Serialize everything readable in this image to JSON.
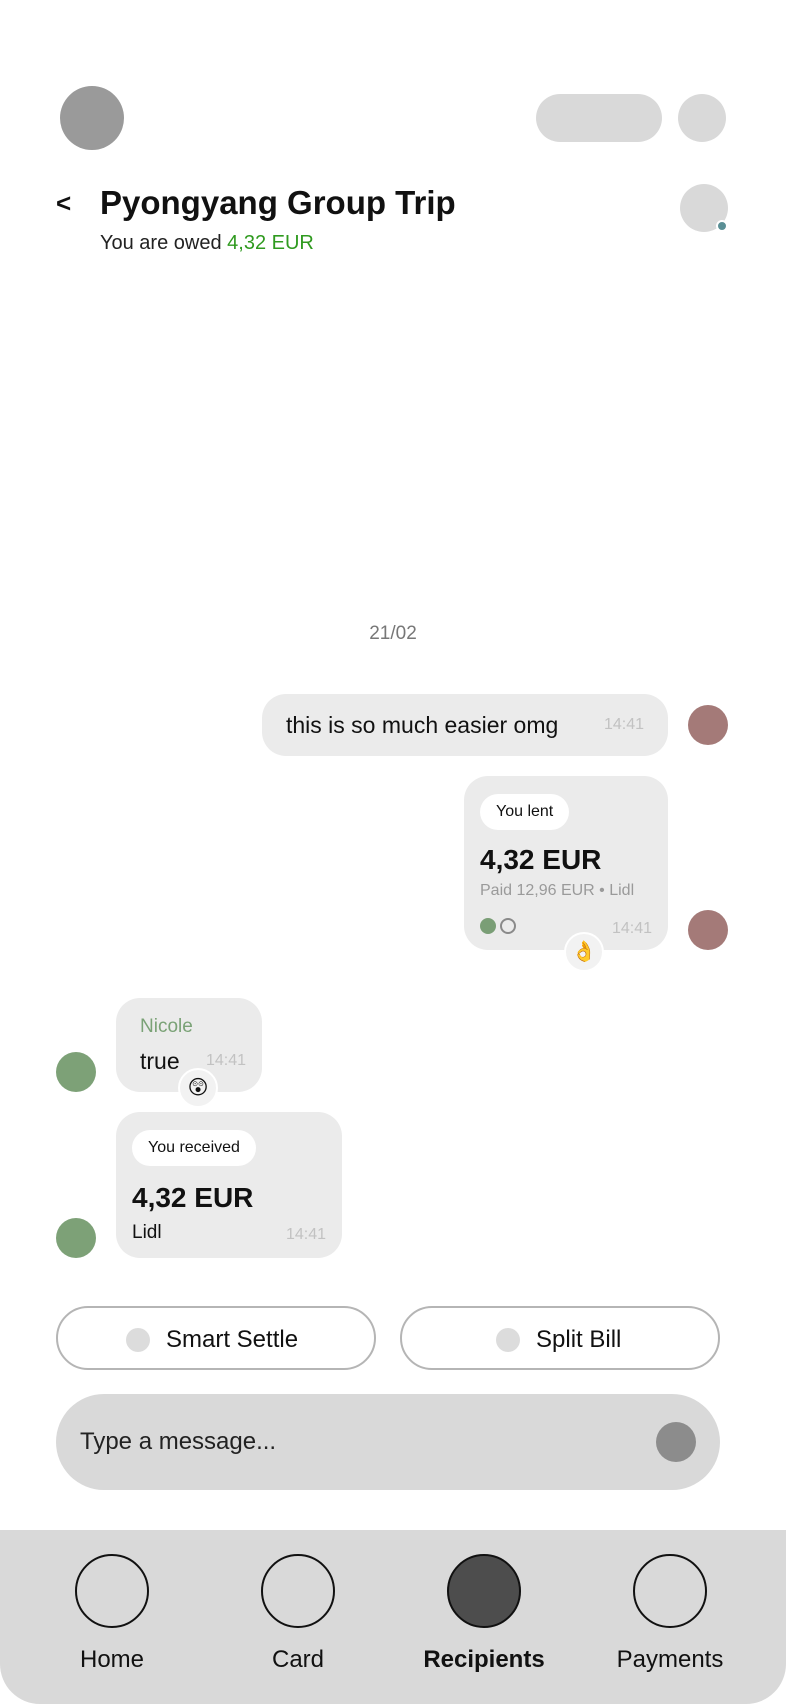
{
  "header": {
    "back_label": "<",
    "title": "Pyongyang Group Trip",
    "owed_prefix": "You are owed",
    "owed_amount": "4,32 EUR"
  },
  "chat": {
    "date_divider": "21/02",
    "messages": [
      {
        "text": "this is so much easier omg",
        "time": "14:41"
      },
      {
        "chip": "You lent",
        "amount": "4,32 EUR",
        "detail": "Paid 12,96 EUR  • Lidl",
        "time": "14:41",
        "reaction": "👌"
      },
      {
        "sender": "Nicole",
        "text": "true",
        "time": "14:41",
        "reaction": "😲"
      },
      {
        "chip": "You received",
        "amount": "4,32 EUR",
        "merchant": "Lidl",
        "time": "14:41"
      }
    ]
  },
  "actions": {
    "smart_settle": "Smart Settle",
    "split_bill": "Split Bill"
  },
  "composer": {
    "placeholder": "Type a message..."
  },
  "nav": {
    "items": [
      {
        "label": "Home"
      },
      {
        "label": "Card"
      },
      {
        "label": "Recipients",
        "active": true
      },
      {
        "label": "Payments"
      }
    ]
  },
  "colors": {
    "owed_green": "#2f9a1f",
    "sender_green": "#7aa276",
    "my_avatar": "#a47a78",
    "nicole_avatar": "#7da177",
    "status_dot_teal": "#5a8f95"
  }
}
